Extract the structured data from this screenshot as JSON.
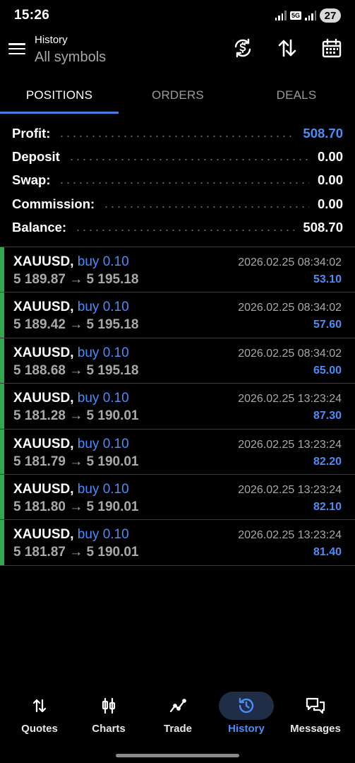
{
  "status_bar": {
    "time": "15:26",
    "network": "5G",
    "battery": "27"
  },
  "app_bar": {
    "title": "History",
    "subtitle": "All symbols",
    "icons": [
      "menu-icon",
      "sync-icon",
      "sort-icon",
      "calendar-icon"
    ]
  },
  "tabs": [
    {
      "label": "POSITIONS",
      "active": true
    },
    {
      "label": "ORDERS",
      "active": false
    },
    {
      "label": "DEALS",
      "active": false
    }
  ],
  "summary": [
    {
      "label": "Profit:",
      "value": "508.70",
      "accent": true
    },
    {
      "label": "Deposit",
      "value": "0.00",
      "accent": false
    },
    {
      "label": "Swap:",
      "value": "0.00",
      "accent": false
    },
    {
      "label": "Commission:",
      "value": "0.00",
      "accent": false
    },
    {
      "label": "Balance:",
      "value": "508.70",
      "accent": false
    }
  ],
  "positions": [
    {
      "symbol": "XAUUSD,",
      "side": "buy 0.10",
      "open": "5 189.87",
      "close": "5 195.18",
      "time": "2026.02.25 08:34:02",
      "profit": "53.10"
    },
    {
      "symbol": "XAUUSD,",
      "side": "buy 0.10",
      "open": "5 189.42",
      "close": "5 195.18",
      "time": "2026.02.25 08:34:02",
      "profit": "57.60"
    },
    {
      "symbol": "XAUUSD,",
      "side": "buy 0.10",
      "open": "5 188.68",
      "close": "5 195.18",
      "time": "2026.02.25 08:34:02",
      "profit": "65.00"
    },
    {
      "symbol": "XAUUSD,",
      "side": "buy 0.10",
      "open": "5 181.28",
      "close": "5 190.01",
      "time": "2026.02.25 13:23:24",
      "profit": "87.30"
    },
    {
      "symbol": "XAUUSD,",
      "side": "buy 0.10",
      "open": "5 181.79",
      "close": "5 190.01",
      "time": "2026.02.25 13:23:24",
      "profit": "82.20"
    },
    {
      "symbol": "XAUUSD,",
      "side": "buy 0.10",
      "open": "5 181.80",
      "close": "5 190.01",
      "time": "2026.02.25 13:23:24",
      "profit": "82.10"
    },
    {
      "symbol": "XAUUSD,",
      "side": "buy 0.10",
      "open": "5 181.87",
      "close": "5 190.01",
      "time": "2026.02.25 13:23:24",
      "profit": "81.40"
    }
  ],
  "arrow": "→",
  "bottom_nav": [
    {
      "label": "Quotes",
      "icon": "quotes-icon",
      "active": false
    },
    {
      "label": "Charts",
      "icon": "charts-icon",
      "active": false
    },
    {
      "label": "Trade",
      "icon": "trade-icon",
      "active": false
    },
    {
      "label": "History",
      "icon": "history-icon",
      "active": true
    },
    {
      "label": "Messages",
      "icon": "messages-icon",
      "active": false
    }
  ],
  "colors": {
    "accent": "#4d8cf5",
    "buy_bar": "#2fa84f",
    "background": "#000000",
    "muted_text": "#a8a8a8"
  }
}
